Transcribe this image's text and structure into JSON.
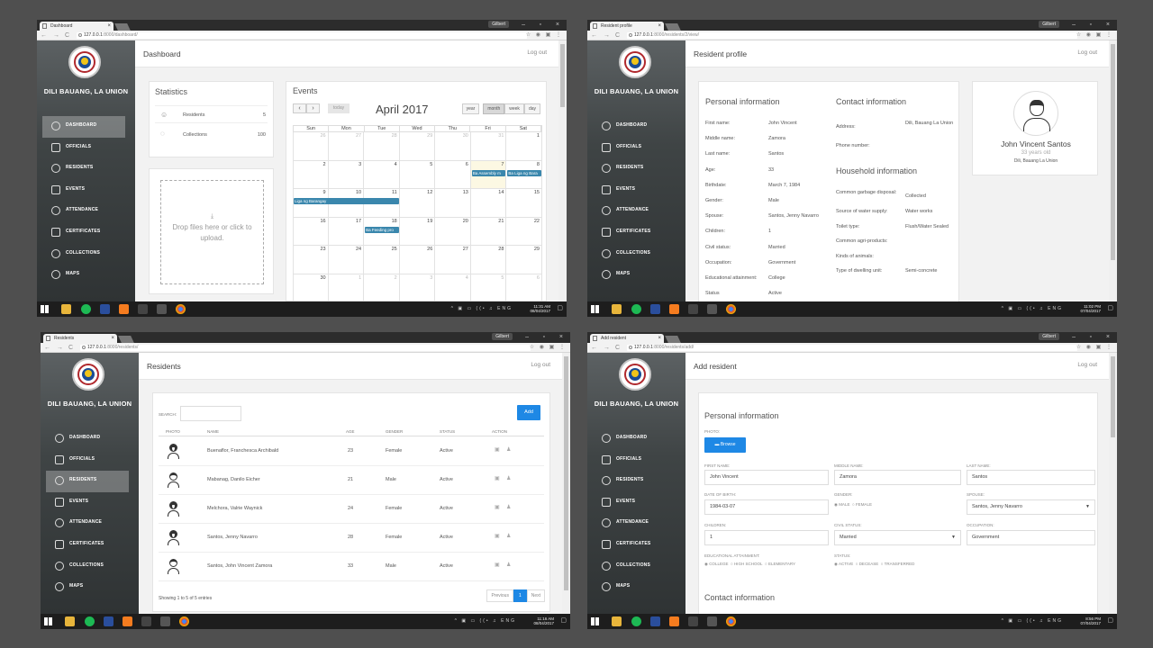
{
  "browser": {
    "user_badge": "Gilbert",
    "dashboard_tab": "Dashboard",
    "profile_tab": "Resident profile",
    "residents_tab": "Residents",
    "add_tab": "Add resident",
    "url_host": "127.0.0.1",
    "url_dashboard": ":8000/dashboard/",
    "url_profile": ":8000/residents/2/view/",
    "url_residents": ":8000/residents/",
    "url_add": ":8000/residents/add/"
  },
  "sidebar": {
    "municipality": "DILI BAUANG, LA UNION",
    "items": [
      {
        "label": "DASHBOARD",
        "icon": "dashboard-icon"
      },
      {
        "label": "OFFICIALS",
        "icon": "shield-icon"
      },
      {
        "label": "RESIDENTS",
        "icon": "people-icon"
      },
      {
        "label": "EVENTS",
        "icon": "calendar-icon"
      },
      {
        "label": "ATTENDANCE",
        "icon": "clock-icon"
      },
      {
        "label": "CERTIFICATES",
        "icon": "clipboard-icon"
      },
      {
        "label": "COLLECTIONS",
        "icon": "piggy-bank-icon"
      },
      {
        "label": "MAPS",
        "icon": "map-pin-icon"
      }
    ]
  },
  "common": {
    "logout": "Log out"
  },
  "dashboard": {
    "title": "Dashboard",
    "statistics_title": "Statistics",
    "stats": [
      {
        "label": "Residents",
        "value": "5"
      },
      {
        "label": "Collections",
        "value": "100"
      }
    ],
    "dropzone_text": "Drop files here or click to upload.",
    "events_title": "Events",
    "today_label": "today",
    "month_title": "April 2017",
    "views": [
      "year",
      "month",
      "week",
      "day"
    ],
    "weekdays": [
      "Sun",
      "Mon",
      "Tue",
      "Wed",
      "Thu",
      "Fri",
      "Sat"
    ],
    "weeks": [
      [
        "26",
        "27",
        "28",
        "29",
        "30",
        "31",
        "1"
      ],
      [
        "2",
        "3",
        "4",
        "5",
        "6",
        "7",
        "8"
      ],
      [
        "9",
        "10",
        "11",
        "12",
        "13",
        "14",
        "15"
      ],
      [
        "16",
        "17",
        "18",
        "19",
        "20",
        "21",
        "22"
      ],
      [
        "23",
        "24",
        "25",
        "26",
        "27",
        "28",
        "29"
      ],
      [
        "30",
        "1",
        "2",
        "3",
        "4",
        "5",
        "6"
      ]
    ],
    "events": [
      {
        "label": "Ba Assembly m"
      },
      {
        "label": "Ba Liga ng Bara"
      },
      {
        "label": "Liga ng Barangay"
      },
      {
        "label": "Ba Feeding pro"
      }
    ],
    "clock_time": "11:31 AM",
    "clock_date": "08/04/2017"
  },
  "profile": {
    "title": "Resident profile",
    "personal_title": "Personal information",
    "contact_title": "Contact information",
    "household_title": "Household information",
    "personal_fields": [
      {
        "label": "First name:",
        "value": "John Vincent"
      },
      {
        "label": "Middle name:",
        "value": "Zamora"
      },
      {
        "label": "Last name:",
        "value": "Santos"
      },
      {
        "label": "Age:",
        "value": "33"
      },
      {
        "label": "Birthdate:",
        "value": "March 7, 1984"
      },
      {
        "label": "Gender:",
        "value": "Male"
      },
      {
        "label": "Spouse:",
        "value": "Santos, Jenny Navarro"
      },
      {
        "label": "Children:",
        "value": "1"
      },
      {
        "label": "Civil status:",
        "value": "Married"
      },
      {
        "label": "Occupation:",
        "value": "Government"
      },
      {
        "label": "Educational attainment:",
        "value": "College"
      },
      {
        "label": "Status",
        "value": "Active"
      }
    ],
    "contact_fields": [
      {
        "label": "Address:",
        "value": "Dili, Bauang La Union"
      },
      {
        "label": "Phone number:",
        "value": ""
      }
    ],
    "household_fields": [
      {
        "label": "Common garbage disposal:",
        "value": "Collected"
      },
      {
        "label": "Source of water supply:",
        "value": "Water works"
      },
      {
        "label": "Toilet type:",
        "value": "Flush/Water Sealed"
      },
      {
        "label": "Common agri-products:",
        "value": ""
      },
      {
        "label": "Kinds of animals:",
        "value": ""
      },
      {
        "label": "Type of dwelling unit:",
        "value": "Semi-concrete"
      }
    ],
    "name": "John Vincent Santos",
    "age_text": "33 years old",
    "address": "Dili, Bauang La Union",
    "clock_time": "11:02 PM",
    "clock_date": "07/04/2017"
  },
  "residents": {
    "title": "Residents",
    "search_label": "SEARCH:",
    "add_button": "Add",
    "columns": [
      "PHOTO",
      "NAME",
      "AGE",
      "GENDER",
      "STATUS",
      "ACTION"
    ],
    "rows": [
      {
        "name": "Buenaflor, Franchesca Archibald",
        "age": "23",
        "gender": "Female",
        "status": "Active"
      },
      {
        "name": "Mabanag, Danilo Eicher",
        "age": "21",
        "gender": "Male",
        "status": "Active"
      },
      {
        "name": "Melchora, Valrie Waynick",
        "age": "24",
        "gender": "Female",
        "status": "Active"
      },
      {
        "name": "Santos, Jenny Navarro",
        "age": "28",
        "gender": "Female",
        "status": "Active"
      },
      {
        "name": "Santos, John Vincent Zamora",
        "age": "33",
        "gender": "Male",
        "status": "Active"
      }
    ],
    "showing": "Showing 1 to 5 of 5 entries",
    "prev": "Previous",
    "page": "1",
    "next": "Next",
    "clock_time": "11:16 AM",
    "clock_date": "08/04/2017"
  },
  "add": {
    "title": "Add resident",
    "personal_title": "Personal information",
    "photo_label": "PHOTO:",
    "browse": "Browse",
    "first_name_label": "FIRST NAME:",
    "first_name": "John Vincent",
    "middle_name_label": "MIDDLE NAME:",
    "middle_name": "Zamora",
    "last_name_label": "LAST NAME:",
    "last_name": "Santos",
    "dob_label": "DATE OF BIRTH:",
    "dob": "1984-03-07",
    "gender_label": "GENDER:",
    "gender_options": [
      "MALE",
      "FEMALE"
    ],
    "spouse_label": "SPOUSE:",
    "spouse": "Santos, Jenny Navarro",
    "children_label": "CHILDREN:",
    "children": "1",
    "civil_label": "CIVIL STATUS:",
    "civil": "Married",
    "occupation_label": "OCCUPATION:",
    "occupation": "Government",
    "edu_label": "EDUCATIONAL ATTAINMENT:",
    "edu_options": [
      "COLLEGE",
      "HIGH SCHOOL",
      "ELEMENTARY"
    ],
    "status_label": "STATUS:",
    "status_options": [
      "ACTIVE",
      "DECEASE",
      "TRANSFERRED"
    ],
    "contact_title": "Contact information",
    "clock_time": "8:56 PM",
    "clock_date": "07/04/2017"
  },
  "colors": {
    "accent": "#1e88e5",
    "event": "#3a87ad",
    "sidebar": "#3f4445"
  }
}
